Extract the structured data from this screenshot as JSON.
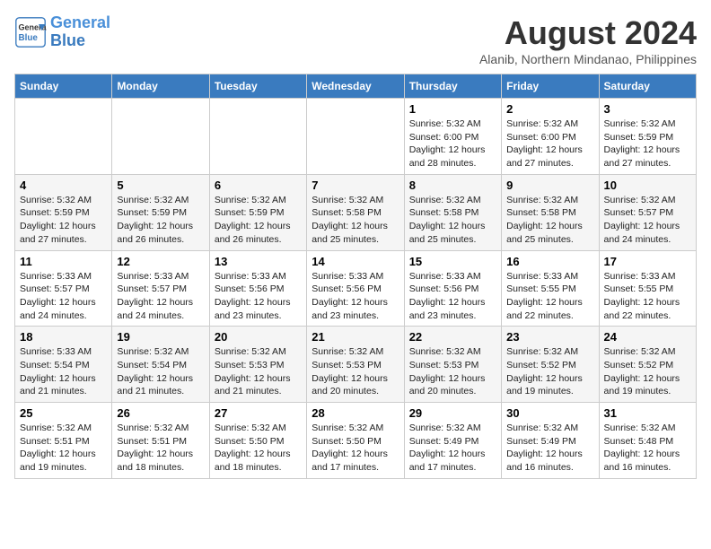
{
  "header": {
    "logo_line1": "General",
    "logo_line2": "Blue",
    "main_title": "August 2024",
    "subtitle": "Alanib, Northern Mindanao, Philippines"
  },
  "columns": [
    "Sunday",
    "Monday",
    "Tuesday",
    "Wednesday",
    "Thursday",
    "Friday",
    "Saturday"
  ],
  "weeks": [
    [
      {
        "day": "",
        "info": ""
      },
      {
        "day": "",
        "info": ""
      },
      {
        "day": "",
        "info": ""
      },
      {
        "day": "",
        "info": ""
      },
      {
        "day": "1",
        "info": "Sunrise: 5:32 AM\nSunset: 6:00 PM\nDaylight: 12 hours\nand 28 minutes."
      },
      {
        "day": "2",
        "info": "Sunrise: 5:32 AM\nSunset: 6:00 PM\nDaylight: 12 hours\nand 27 minutes."
      },
      {
        "day": "3",
        "info": "Sunrise: 5:32 AM\nSunset: 5:59 PM\nDaylight: 12 hours\nand 27 minutes."
      }
    ],
    [
      {
        "day": "4",
        "info": "Sunrise: 5:32 AM\nSunset: 5:59 PM\nDaylight: 12 hours\nand 27 minutes."
      },
      {
        "day": "5",
        "info": "Sunrise: 5:32 AM\nSunset: 5:59 PM\nDaylight: 12 hours\nand 26 minutes."
      },
      {
        "day": "6",
        "info": "Sunrise: 5:32 AM\nSunset: 5:59 PM\nDaylight: 12 hours\nand 26 minutes."
      },
      {
        "day": "7",
        "info": "Sunrise: 5:32 AM\nSunset: 5:58 PM\nDaylight: 12 hours\nand 25 minutes."
      },
      {
        "day": "8",
        "info": "Sunrise: 5:32 AM\nSunset: 5:58 PM\nDaylight: 12 hours\nand 25 minutes."
      },
      {
        "day": "9",
        "info": "Sunrise: 5:32 AM\nSunset: 5:58 PM\nDaylight: 12 hours\nand 25 minutes."
      },
      {
        "day": "10",
        "info": "Sunrise: 5:32 AM\nSunset: 5:57 PM\nDaylight: 12 hours\nand 24 minutes."
      }
    ],
    [
      {
        "day": "11",
        "info": "Sunrise: 5:33 AM\nSunset: 5:57 PM\nDaylight: 12 hours\nand 24 minutes."
      },
      {
        "day": "12",
        "info": "Sunrise: 5:33 AM\nSunset: 5:57 PM\nDaylight: 12 hours\nand 24 minutes."
      },
      {
        "day": "13",
        "info": "Sunrise: 5:33 AM\nSunset: 5:56 PM\nDaylight: 12 hours\nand 23 minutes."
      },
      {
        "day": "14",
        "info": "Sunrise: 5:33 AM\nSunset: 5:56 PM\nDaylight: 12 hours\nand 23 minutes."
      },
      {
        "day": "15",
        "info": "Sunrise: 5:33 AM\nSunset: 5:56 PM\nDaylight: 12 hours\nand 23 minutes."
      },
      {
        "day": "16",
        "info": "Sunrise: 5:33 AM\nSunset: 5:55 PM\nDaylight: 12 hours\nand 22 minutes."
      },
      {
        "day": "17",
        "info": "Sunrise: 5:33 AM\nSunset: 5:55 PM\nDaylight: 12 hours\nand 22 minutes."
      }
    ],
    [
      {
        "day": "18",
        "info": "Sunrise: 5:33 AM\nSunset: 5:54 PM\nDaylight: 12 hours\nand 21 minutes."
      },
      {
        "day": "19",
        "info": "Sunrise: 5:32 AM\nSunset: 5:54 PM\nDaylight: 12 hours\nand 21 minutes."
      },
      {
        "day": "20",
        "info": "Sunrise: 5:32 AM\nSunset: 5:53 PM\nDaylight: 12 hours\nand 21 minutes."
      },
      {
        "day": "21",
        "info": "Sunrise: 5:32 AM\nSunset: 5:53 PM\nDaylight: 12 hours\nand 20 minutes."
      },
      {
        "day": "22",
        "info": "Sunrise: 5:32 AM\nSunset: 5:53 PM\nDaylight: 12 hours\nand 20 minutes."
      },
      {
        "day": "23",
        "info": "Sunrise: 5:32 AM\nSunset: 5:52 PM\nDaylight: 12 hours\nand 19 minutes."
      },
      {
        "day": "24",
        "info": "Sunrise: 5:32 AM\nSunset: 5:52 PM\nDaylight: 12 hours\nand 19 minutes."
      }
    ],
    [
      {
        "day": "25",
        "info": "Sunrise: 5:32 AM\nSunset: 5:51 PM\nDaylight: 12 hours\nand 19 minutes."
      },
      {
        "day": "26",
        "info": "Sunrise: 5:32 AM\nSunset: 5:51 PM\nDaylight: 12 hours\nand 18 minutes."
      },
      {
        "day": "27",
        "info": "Sunrise: 5:32 AM\nSunset: 5:50 PM\nDaylight: 12 hours\nand 18 minutes."
      },
      {
        "day": "28",
        "info": "Sunrise: 5:32 AM\nSunset: 5:50 PM\nDaylight: 12 hours\nand 17 minutes."
      },
      {
        "day": "29",
        "info": "Sunrise: 5:32 AM\nSunset: 5:49 PM\nDaylight: 12 hours\nand 17 minutes."
      },
      {
        "day": "30",
        "info": "Sunrise: 5:32 AM\nSunset: 5:49 PM\nDaylight: 12 hours\nand 16 minutes."
      },
      {
        "day": "31",
        "info": "Sunrise: 5:32 AM\nSunset: 5:48 PM\nDaylight: 12 hours\nand 16 minutes."
      }
    ]
  ]
}
